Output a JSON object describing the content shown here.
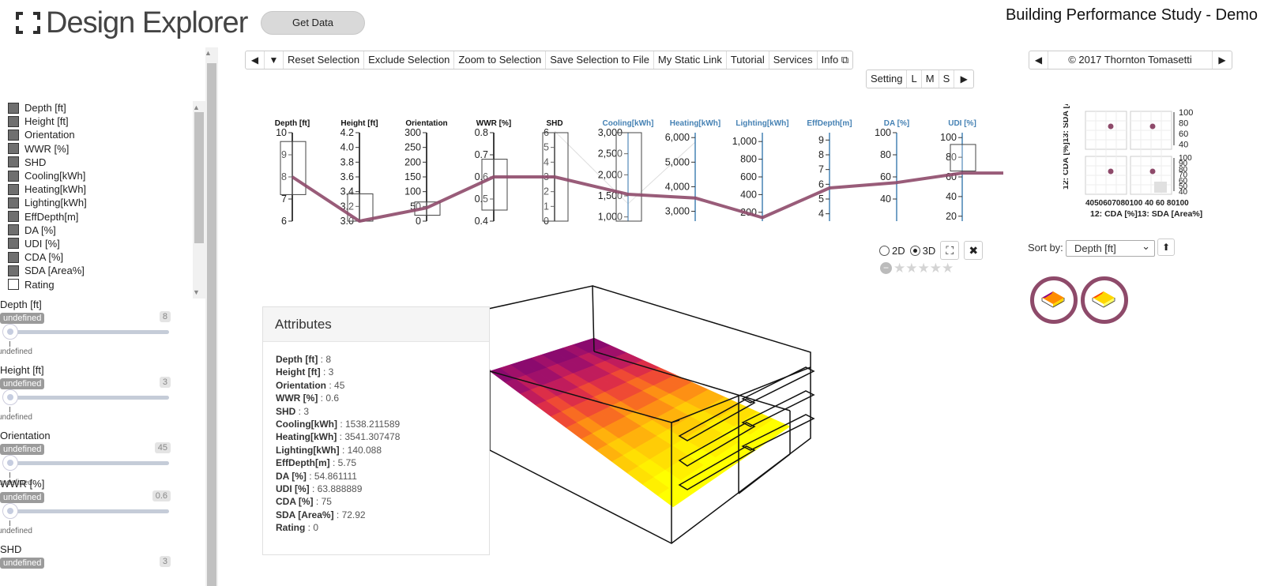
{
  "header": {
    "logo_text": "Design Explorer",
    "get_data": "Get Data",
    "title": "Building Performance Study - Demo"
  },
  "toolbar": {
    "buttons": [
      "Reset Selection",
      "Exclude Selection",
      "Zoom to Selection",
      "Save Selection to File",
      "My Static Link",
      "Tutorial",
      "Services",
      "Info"
    ],
    "size_buttons": [
      "Setting",
      "L",
      "M",
      "S"
    ],
    "copyright": "© 2017 Thornton Tomasetti"
  },
  "attribute_list": [
    {
      "label": "Depth [ft]",
      "checked": true
    },
    {
      "label": "Height [ft]",
      "checked": true
    },
    {
      "label": "Orientation",
      "checked": true
    },
    {
      "label": "WWR [%]",
      "checked": true
    },
    {
      "label": "SHD",
      "checked": true
    },
    {
      "label": "Cooling[kWh]",
      "checked": true
    },
    {
      "label": "Heating[kWh]",
      "checked": true
    },
    {
      "label": "Lighting[kWh]",
      "checked": true
    },
    {
      "label": "EffDepth[m]",
      "checked": true
    },
    {
      "label": "DA [%]",
      "checked": true
    },
    {
      "label": "UDI [%]",
      "checked": true
    },
    {
      "label": "CDA [%]",
      "checked": true
    },
    {
      "label": "SDA [Area%]",
      "checked": true
    },
    {
      "label": "Rating",
      "checked": false
    }
  ],
  "filters": [
    {
      "label": "Depth [ft]",
      "pill": "undefined",
      "value": "8",
      "sub": "undefined"
    },
    {
      "label": "Height [ft]",
      "pill": "undefined",
      "value": "3",
      "sub": "undefined"
    },
    {
      "label": "Orientation",
      "pill": "undefined",
      "value": "45",
      "sub": "undefined"
    },
    {
      "label": "WWR [%]",
      "pill": "undefined",
      "value": "0.6",
      "sub": "undefined"
    },
    {
      "label": "SHD",
      "pill": "undefined",
      "value": "3",
      "sub": ""
    }
  ],
  "chart_data": {
    "type": "parallel-coordinates",
    "axes": [
      {
        "name": "Depth [ft]",
        "ticks": [
          "10",
          "9",
          "8",
          "7",
          "6"
        ],
        "range": [
          6,
          10
        ],
        "color": "#000000"
      },
      {
        "name": "Height [ft]",
        "ticks": [
          "4.2",
          "4.0",
          "3.8",
          "3.6",
          "3.4",
          "3.2",
          "3.0"
        ],
        "range": [
          3.0,
          4.2
        ],
        "color": "#000000"
      },
      {
        "name": "Orientation",
        "ticks": [
          "300",
          "250",
          "200",
          "150",
          "100",
          "50",
          "0"
        ],
        "range": [
          0,
          300
        ],
        "color": "#000000"
      },
      {
        "name": "WWR [%]",
        "ticks": [
          "0.8",
          "0.7",
          "0.6",
          "0.5",
          "0.4"
        ],
        "range": [
          0.4,
          0.8
        ],
        "color": "#000000"
      },
      {
        "name": "SHD",
        "ticks": [
          "6",
          "5",
          "4",
          "3",
          "2",
          "1",
          "0"
        ],
        "range": [
          0,
          6
        ],
        "color": "#000000"
      },
      {
        "name": "Cooling[kWh]",
        "ticks": [
          "3,000",
          "2,500",
          "2,000",
          "1,500",
          "1,000"
        ],
        "range": [
          900,
          3000
        ],
        "color": "#4682b4"
      },
      {
        "name": "Heating[kWh]",
        "ticks": [
          "6,000",
          "5,000",
          "4,000",
          "3,000"
        ],
        "range": [
          2600,
          6200
        ],
        "color": "#4682b4"
      },
      {
        "name": "Lighting[kWh]",
        "ticks": [
          "1,000",
          "800",
          "600",
          "400",
          "200"
        ],
        "range": [
          100,
          1100
        ],
        "color": "#4682b4"
      },
      {
        "name": "EffDepth[m]",
        "ticks": [
          "9",
          "8",
          "7",
          "6",
          "5",
          "4"
        ],
        "range": [
          3.5,
          9.5
        ],
        "color": "#4682b4"
      },
      {
        "name": "DA [%]",
        "ticks": [
          "100",
          "80",
          "60",
          "40"
        ],
        "range": [
          20,
          100
        ],
        "color": "#4682b4"
      },
      {
        "name": "UDI [%]",
        "ticks": [
          "100",
          "80",
          "60",
          "40",
          "20"
        ],
        "range": [
          15,
          105
        ],
        "color": "#4682b4"
      }
    ],
    "highlighted_design": [
      8,
      3,
      45,
      0.6,
      3,
      1538.211589,
      3541.307478,
      140.088,
      5.75,
      54.861111,
      63.888889
    ],
    "brushes": [
      {
        "axis": "Depth [ft]",
        "range": [
          7.2,
          9.6
        ]
      },
      {
        "axis": "Height [ft]",
        "range": [
          3.0,
          3.37
        ]
      },
      {
        "axis": "Orientation",
        "range": [
          20,
          65
        ]
      },
      {
        "axis": "WWR [%]",
        "range": [
          0.45,
          0.68
        ]
      },
      {
        "axis": "SHD",
        "range": [
          0,
          6
        ]
      },
      {
        "axis": "Cooling[kWh]",
        "range": [
          900,
          3000
        ]
      },
      {
        "axis": "UDI [%]",
        "range": [
          66,
          93
        ]
      }
    ]
  },
  "view": {
    "dim2d": "2D",
    "dim3d": "3D",
    "selected": "3D",
    "rating_stars": 5
  },
  "attributes_panel": {
    "title": "Attributes",
    "rows": [
      {
        "k": "Depth [ft]",
        "v": " : 8"
      },
      {
        "k": "Height [ft]",
        "v": " : 3"
      },
      {
        "k": "Orientation",
        "v": " : 45"
      },
      {
        "k": "WWR [%]",
        "v": " : 0.6"
      },
      {
        "k": "SHD",
        "v": " : 3"
      },
      {
        "k": "Cooling[kWh]",
        "v": " : 1538.211589"
      },
      {
        "k": "Heating[kWh]",
        "v": " : 3541.307478"
      },
      {
        "k": "Lighting[kWh]",
        "v": " : 140.088"
      },
      {
        "k": "EffDepth[m]",
        "v": " : 5.75"
      },
      {
        "k": "DA [%]",
        "v": " : 54.861111"
      },
      {
        "k": "UDI [%]",
        "v": " : 63.888889"
      },
      {
        "k": "CDA [%]",
        "v": " : 75"
      },
      {
        "k": "SDA [Area%]",
        "v": " : 72.92"
      },
      {
        "k": "Rating",
        "v": " : 0"
      }
    ]
  },
  "scatter_matrix": {
    "y_label": "12: CDA [%]13: SDA [Area%]",
    "x_label": "12: CDA [%]13: SDA [Area%]",
    "x_ticks": "4050607080100 40 60 80100",
    "right_ticks_top": [
      "100",
      "80",
      "60",
      "40"
    ],
    "right_ticks_bottom": [
      "100",
      "90",
      "80",
      "70",
      "60",
      "50",
      "40"
    ],
    "point": {
      "CDA [%]": 75,
      "SDA [Area%]": 72.92
    }
  },
  "sort": {
    "label": "Sort by:",
    "selected": "Depth [ft]"
  },
  "colors": {
    "highlight_line": "#8e4a6a",
    "axis_output": "#4682b4",
    "heat_low": "#ffff00",
    "heat_high": "#8b008b"
  }
}
